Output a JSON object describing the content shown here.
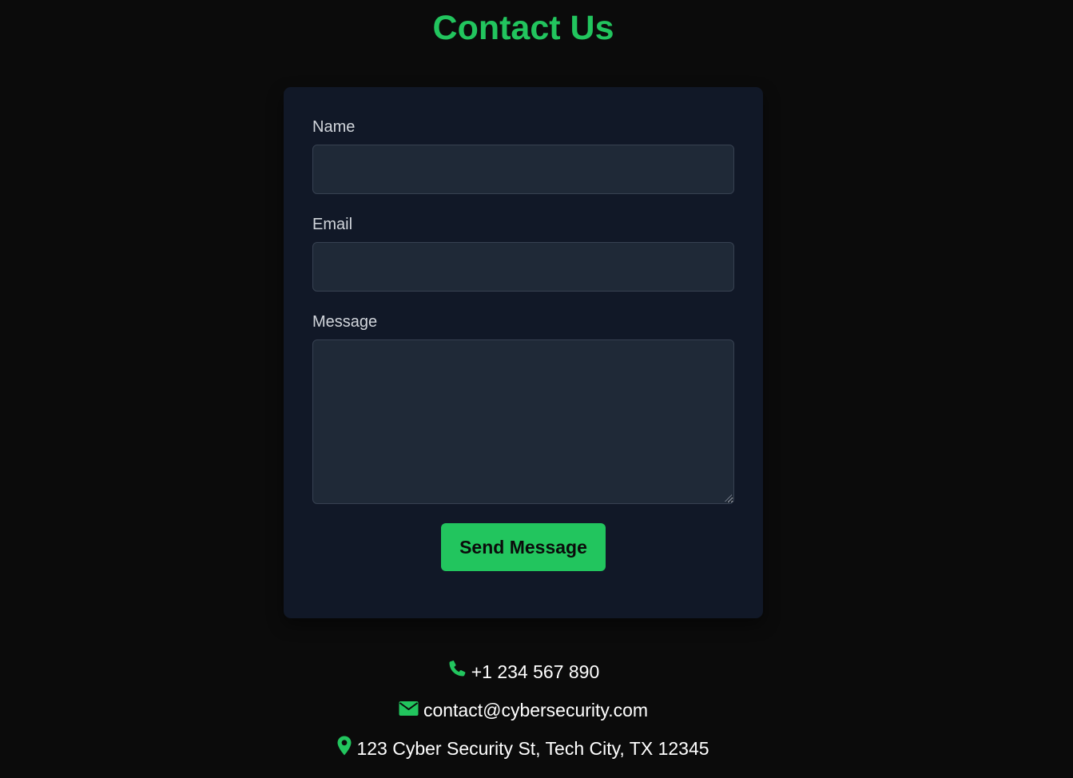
{
  "header": {
    "title": "Contact Us"
  },
  "form": {
    "name_label": "Name",
    "name_value": "",
    "email_label": "Email",
    "email_value": "",
    "message_label": "Message",
    "message_value": "",
    "submit_label": "Send Message"
  },
  "contact": {
    "phone": "+1 234 567 890",
    "email": "contact@cybersecurity.com",
    "address": "123 Cyber Security St, Tech City, TX 12345"
  },
  "icons": {
    "phone": "phone-icon",
    "email": "envelope-icon",
    "address": "map-marker-icon"
  },
  "colors": {
    "accent": "#22c55e",
    "background": "#0b0b0b",
    "card": "#111827",
    "field": "#1f2937"
  }
}
